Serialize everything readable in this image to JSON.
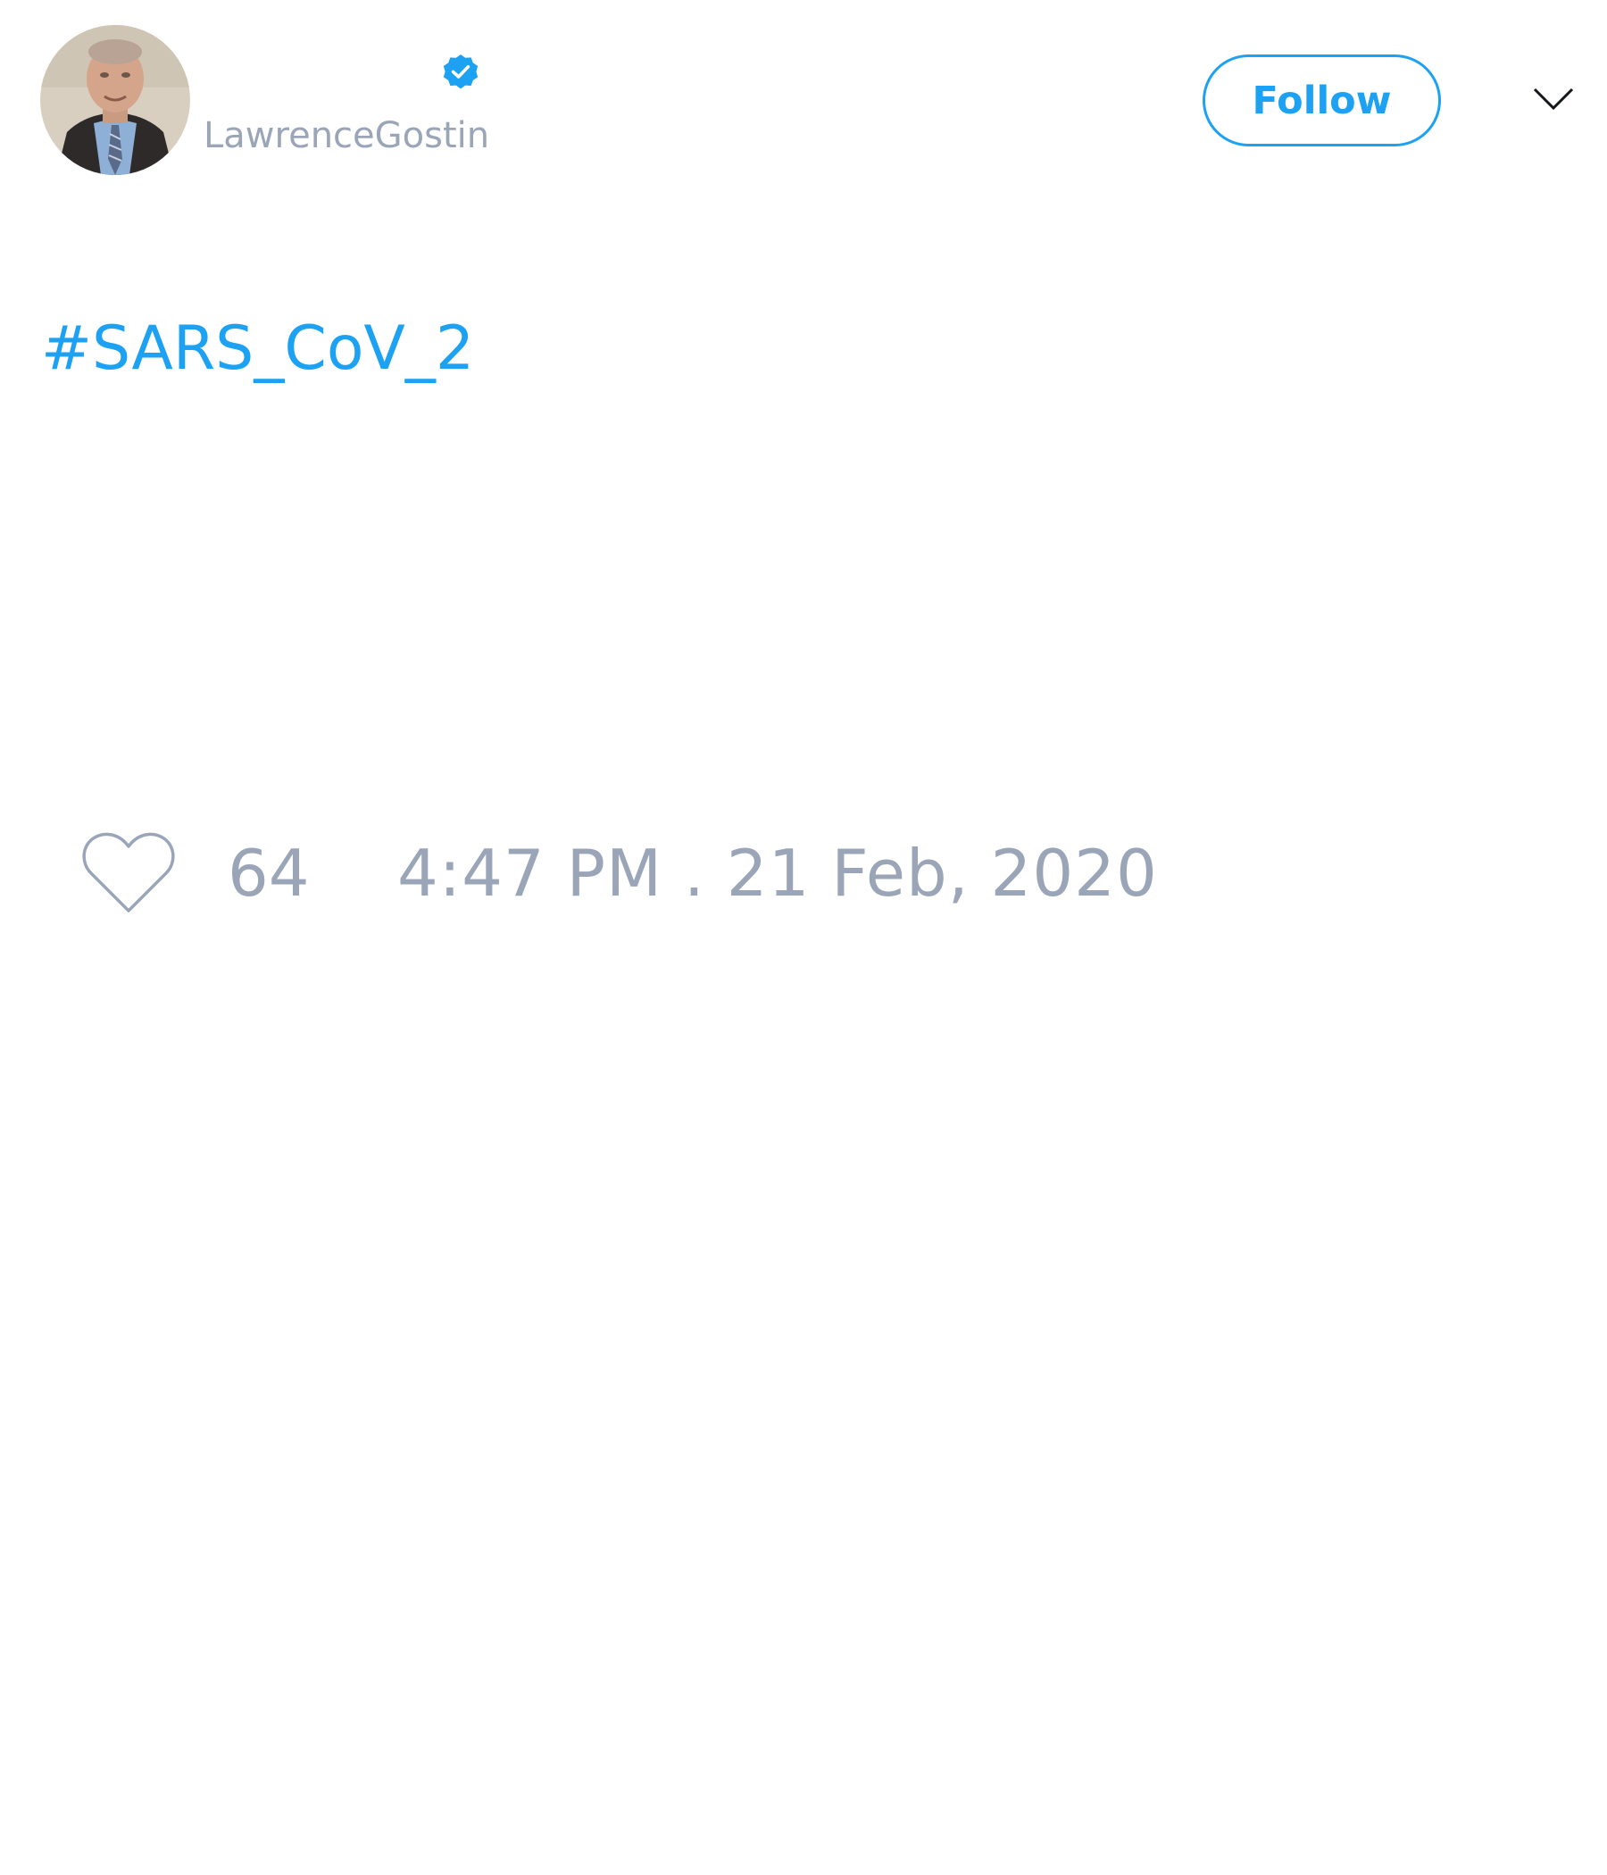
{
  "tweet": {
    "author": {
      "handle": "LawrenceGostin",
      "avatar_icon": "profile-photo",
      "verified": true,
      "verified_icon": "verified-badge-icon"
    },
    "follow_label": "Follow",
    "menu_icon": "chevron-down-icon",
    "text": "#SARS_CoV_2",
    "likes": "64",
    "like_icon": "heart-outline-icon",
    "timestamp": "4:47 PM . 21 Feb, 2020"
  },
  "colors": {
    "accent": "#1da1f2",
    "muted_text": "#9aa6b8",
    "background": "#ffffff"
  }
}
